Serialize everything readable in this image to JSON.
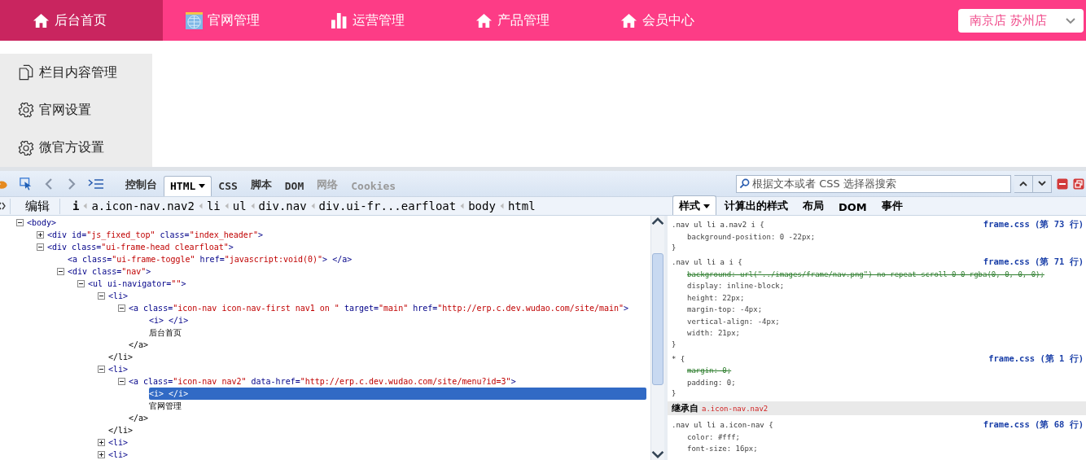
{
  "top_nav": {
    "items": [
      {
        "label": "后台首页",
        "kind": "home",
        "selected": true
      },
      {
        "label": "官网管理",
        "kind": "globe",
        "selected": false
      },
      {
        "label": "运营管理",
        "kind": "chart",
        "selected": false
      },
      {
        "label": "产品管理",
        "kind": "home",
        "selected": false
      },
      {
        "label": "会员中心",
        "kind": "home",
        "selected": false
      }
    ],
    "store_select": {
      "value": "南京店 苏州店"
    }
  },
  "sidebar": {
    "items": [
      {
        "label": "栏目内容管理",
        "kind": "document"
      },
      {
        "label": "官网设置",
        "kind": "gear"
      },
      {
        "label": "微官方设置",
        "kind": "gear"
      }
    ]
  },
  "devtools": {
    "tabs": [
      {
        "label": "控制台",
        "selected": false,
        "disabled": false,
        "dropdown": false
      },
      {
        "label": "HTML",
        "selected": true,
        "disabled": false,
        "dropdown": true
      },
      {
        "label": "CSS",
        "selected": false,
        "disabled": false,
        "dropdown": false
      },
      {
        "label": "脚本",
        "selected": false,
        "disabled": false,
        "dropdown": false
      },
      {
        "label": "DOM",
        "selected": false,
        "disabled": false,
        "dropdown": false
      },
      {
        "label": "网络",
        "selected": false,
        "disabled": true,
        "dropdown": false
      },
      {
        "label": "Cookies",
        "selected": false,
        "disabled": true,
        "dropdown": false
      }
    ],
    "search": {
      "placeholder": "根据文本或者 CSS 选择器搜索"
    },
    "edit_button": "编辑",
    "breadcrumb": [
      {
        "label": "i",
        "selected": true
      },
      {
        "label": "a.icon-nav.nav2",
        "selected": false
      },
      {
        "label": "li",
        "selected": false
      },
      {
        "label": "ul",
        "selected": false
      },
      {
        "label": "div.nav",
        "selected": false
      },
      {
        "label": "div.ui-fr...earfloat",
        "selected": false
      },
      {
        "label": "body",
        "selected": false
      },
      {
        "label": "html",
        "selected": false
      }
    ],
    "side_tabs": [
      {
        "label": "样式",
        "selected": true,
        "dropdown": true
      },
      {
        "label": "计算出的样式",
        "selected": false,
        "dropdown": false
      },
      {
        "label": "布局",
        "selected": false,
        "dropdown": false
      },
      {
        "label": "DOM",
        "selected": false,
        "dropdown": false
      },
      {
        "label": "事件",
        "selected": false,
        "dropdown": false
      }
    ],
    "tree": {
      "nodes": [
        {
          "kind": "element",
          "open": "<body>",
          "expanded": true,
          "selected": false,
          "children": [
            {
              "kind": "element",
              "open": "<div id=\"js_fixed_top\" class=\"index_header\">",
              "expanded": false,
              "selected": false
            },
            {
              "kind": "element",
              "open": "<div class=\"ui-frame-head clearfloat\">",
              "expanded": true,
              "selected": false,
              "children": [
                {
                  "kind": "inline",
                  "open": "<a class=\"ui-frame-toggle\" href=\"javascript:void(0)\"> </a>",
                  "selected": false
                },
                {
                  "kind": "element",
                  "open": "<div class=\"nav\">",
                  "expanded": true,
                  "selected": false,
                  "children": [
                    {
                      "kind": "element",
                      "open": "<ul ui-navigator=\"\">",
                      "expanded": true,
                      "selected": false,
                      "children": [
                        {
                          "kind": "element",
                          "open": "<li>",
                          "close": "</li>",
                          "expanded": true,
                          "selected": false,
                          "children": [
                            {
                              "kind": "element",
                              "open": "<a class=\"icon-nav icon-nav-first nav1 on \" target=\"main\" href=\"http://erp.c.dev.wudao.com/site/main\">",
                              "close": "</a>",
                              "expanded": true,
                              "selected": false,
                              "children": [
                                {
                                  "kind": "inline",
                                  "open": "<i> </i>",
                                  "selected": false
                                },
                                {
                                  "kind": "text",
                                  "open": "后台首页",
                                  "selected": false
                                }
                              ]
                            }
                          ]
                        },
                        {
                          "kind": "element",
                          "open": "<li>",
                          "close": "</li>",
                          "expanded": true,
                          "selected": false,
                          "children": [
                            {
                              "kind": "element",
                              "open": "<a class=\"icon-nav nav2\" data-href=\"http://erp.c.dev.wudao.com/site/menu?id=3\">",
                              "close": "</a>",
                              "expanded": true,
                              "selected": false,
                              "children": [
                                {
                                  "kind": "inline",
                                  "open": "<i> </i>",
                                  "selected": true
                                },
                                {
                                  "kind": "text",
                                  "open": "官网管理",
                                  "selected": false
                                }
                              ]
                            }
                          ]
                        },
                        {
                          "kind": "element",
                          "open": "<li>",
                          "expanded": false,
                          "selected": false
                        },
                        {
                          "kind": "element",
                          "open": "<li>",
                          "expanded": false,
                          "selected": false
                        }
                      ]
                    }
                  ]
                }
              ]
            }
          ]
        }
      ]
    },
    "styles": {
      "rules": [
        {
          "selector": ".nav ul li a.nav2 i {",
          "source": "frame.css (第 73 行)",
          "declarations": [
            {
              "text": "background-position: 0 -22px;",
              "overridden": false
            }
          ],
          "end": "}"
        },
        {
          "selector": ".nav ul li a i {",
          "source": "frame.css (第 71 行)",
          "declarations": [
            {
              "text": "background: url(\"../images/frame/nav.png\") no-repeat scroll 0 0 rgba(0, 0, 0, 0);",
              "overridden": true
            },
            {
              "text": "display: inline-block;",
              "overridden": false
            },
            {
              "text": "height: 22px;",
              "overridden": false
            },
            {
              "text": "margin-top: -4px;",
              "overridden": false
            },
            {
              "text": "vertical-align: -4px;",
              "overridden": false
            },
            {
              "text": "width: 21px;",
              "overridden": false
            }
          ],
          "end": "}"
        },
        {
          "selector": "* {",
          "source": "frame.css (第 1 行)",
          "declarations": [
            {
              "text": "margin: 0;",
              "overridden": true
            },
            {
              "text": "padding: 0;",
              "overridden": false
            }
          ],
          "end": "}"
        }
      ],
      "inherited": {
        "label": "继承自",
        "selector": "a.icon-nav.nav2"
      },
      "inherited_rules": [
        {
          "selector": ".nav ul li a.icon-nav {",
          "source": "frame.css (第 68 行)",
          "declarations": [
            {
              "text": "color: #fff;",
              "overridden": false
            },
            {
              "text": "font-size: 16px;",
              "overridden": false
            }
          ]
        }
      ]
    }
  }
}
